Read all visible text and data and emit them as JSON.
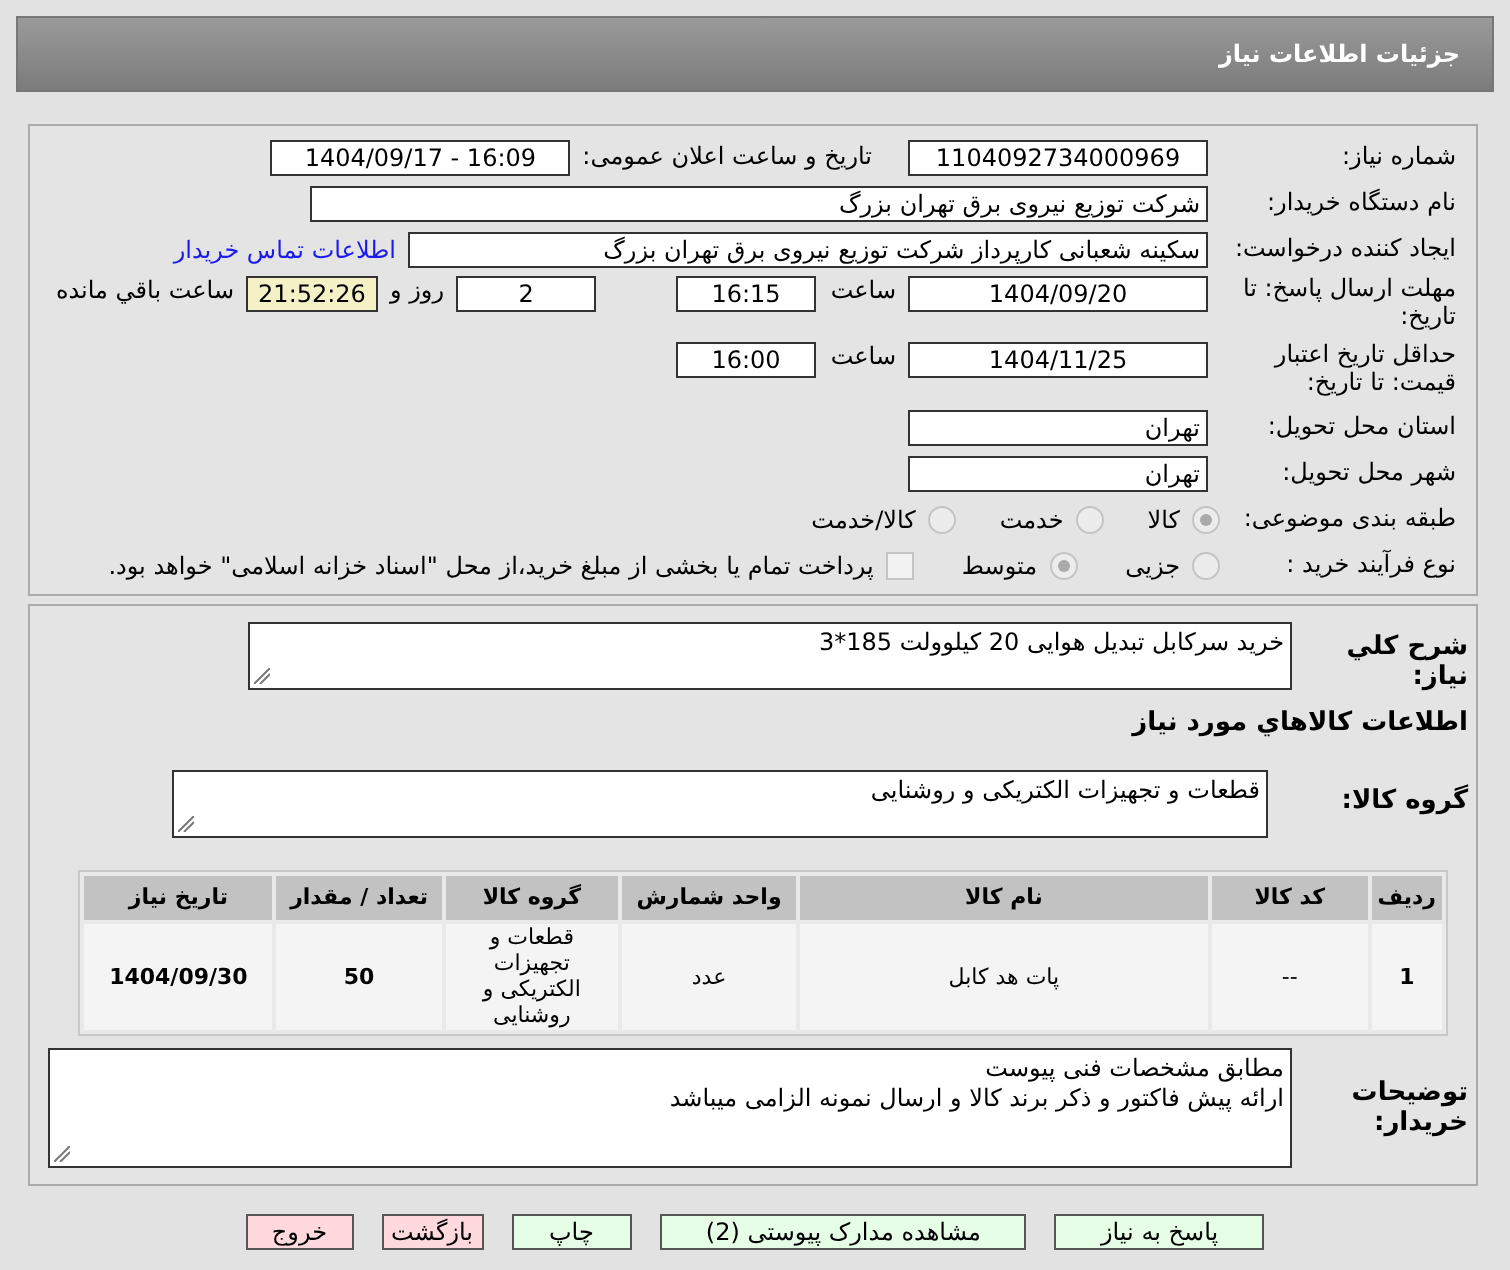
{
  "title": "جزئیات اطلاعات نیاز",
  "need_number": {
    "label": "شماره نیاز:",
    "value": "1104092734000969"
  },
  "announce": {
    "label": "تاریخ و ساعت اعلان عمومی:",
    "value": "1404/09/17 - 16:09"
  },
  "buyer": {
    "label": "نام دستگاه خریدار:",
    "value": "شرکت توزیع نیروی برق تهران بزرگ"
  },
  "requester": {
    "label": "ایجاد کننده درخواست:",
    "value": "سکینه شعبانی کارپرداز شرکت توزیع نیروی برق تهران بزرگ",
    "link": "اطلاعات تماس خریدار"
  },
  "deadline": {
    "label": "مهلت ارسال پاسخ: تا تاریخ:",
    "date": "1404/09/20",
    "time_label": "ساعت",
    "time": "16:15",
    "days": "2",
    "days_label": "روز و",
    "remaining": "21:52:26",
    "remaining_label": "ساعت باقي مانده"
  },
  "validity": {
    "label": "حداقل تاریخ اعتبار قیمت: تا تاریخ:",
    "date": "1404/11/25",
    "time_label": "ساعت",
    "time": "16:00"
  },
  "province": {
    "label": "استان محل تحویل:",
    "value": "تهران"
  },
  "city": {
    "label": "شهر محل تحویل:",
    "value": "تهران"
  },
  "category": {
    "label": "طبقه بندی موضوعی:",
    "options": [
      {
        "label": "کالا",
        "selected": true
      },
      {
        "label": "خدمت",
        "selected": false
      },
      {
        "label": "کالا/خدمت",
        "selected": false
      }
    ]
  },
  "process": {
    "label": "نوع فرآیند خرید :",
    "options": [
      {
        "label": "جزیی",
        "selected": false
      },
      {
        "label": "متوسط",
        "selected": true
      }
    ],
    "treasury": {
      "label": "پرداخت تمام یا بخشی از مبلغ خرید،از محل \"اسناد خزانه اسلامی\" خواهد بود.",
      "checked": false
    }
  },
  "description": {
    "label": "شرح کلي نياز:",
    "value": "خرید سرکابل تبدیل هوایی 20 کیلوولت 185*3"
  },
  "goods_heading": "اطلاعات کالاهاي مورد نياز",
  "goods_group": {
    "label": "گروه کالا:",
    "value": "قطعات و تجهیزات الکتریکی و روشنایی"
  },
  "table": {
    "columns": [
      "ردیف",
      "کد کالا",
      "نام کالا",
      "واحد شمارش",
      "گروه کالا",
      "تعداد / مقدار",
      "تاریخ نیاز"
    ],
    "rows": [
      [
        "1",
        "--",
        "پات هد کابل",
        "عدد",
        "قطعات و تجهیزات الکتریکی و روشنایی",
        "50",
        "1404/09/30"
      ]
    ]
  },
  "notes": {
    "label": "توضیحات خریدار:",
    "lines": [
      "مطابق مشخصات فنی پیوست",
      "ارائه پیش فاکتور و ذکر برند کالا و ارسال نمونه الزامی میباشد"
    ]
  },
  "buttons": [
    {
      "label": "پاسخ به نیاز",
      "kind": "green"
    },
    {
      "label": "مشاهده مدارک پیوستی (2)",
      "kind": "green"
    },
    {
      "label": "چاپ",
      "kind": "green"
    },
    {
      "label": "بازگشت",
      "kind": "pink"
    },
    {
      "label": "خروج",
      "kind": "pink"
    }
  ]
}
